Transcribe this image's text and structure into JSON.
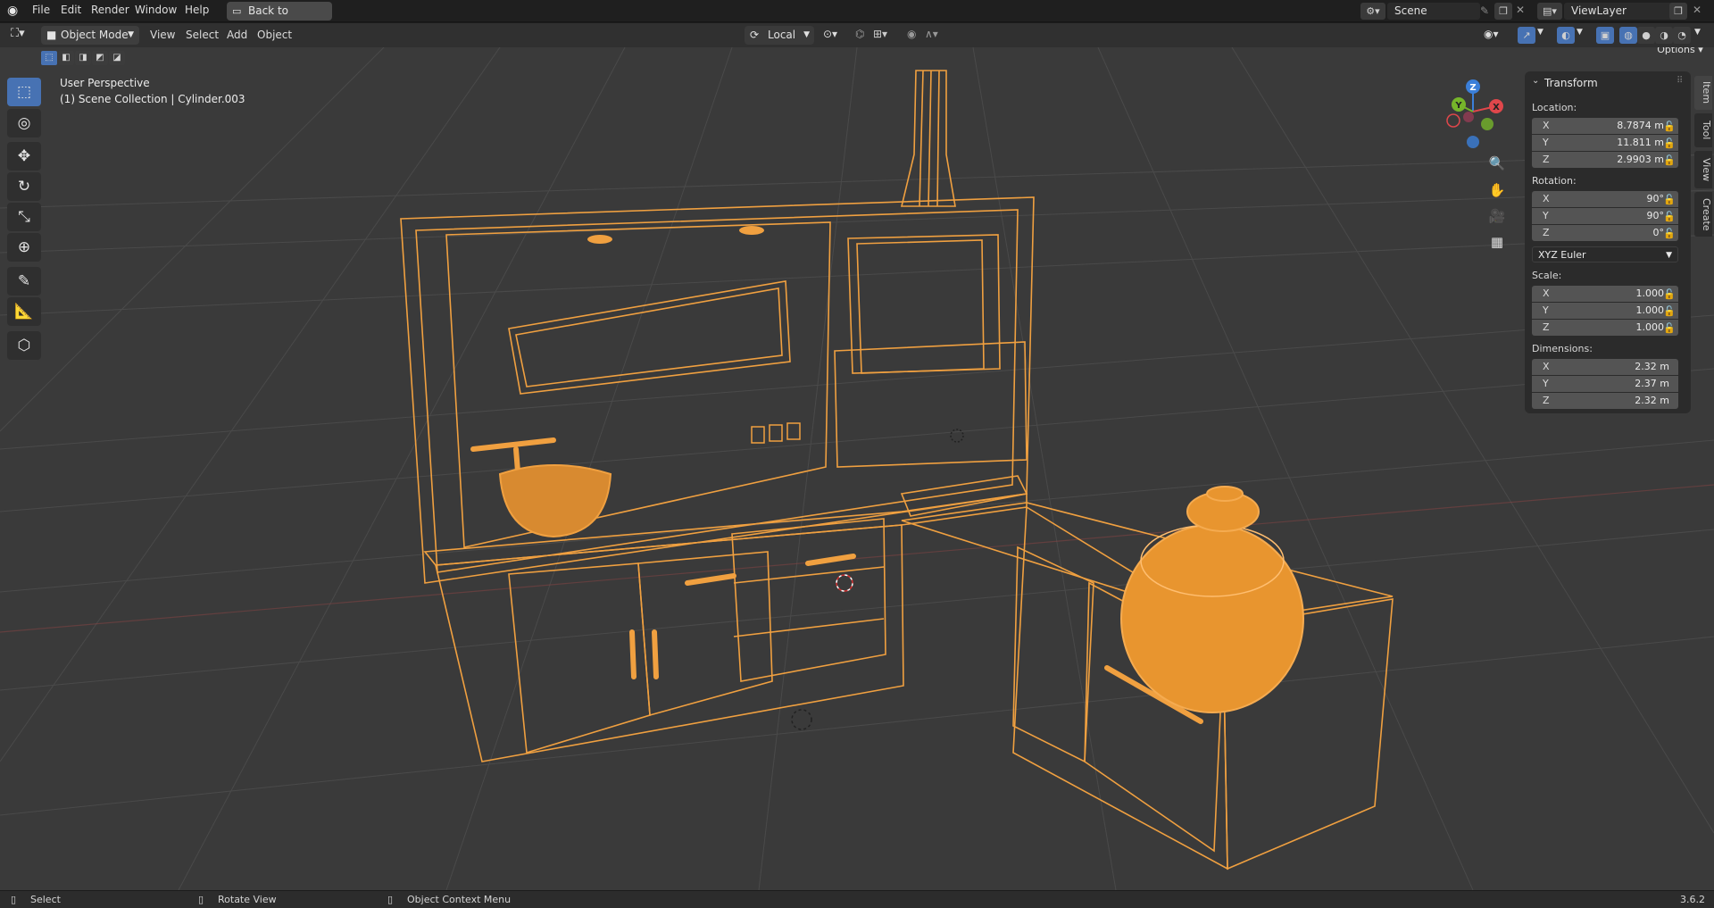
{
  "topbar": {
    "menus": [
      "File",
      "Edit",
      "Render",
      "Window",
      "Help"
    ],
    "back_button": "Back to Previous",
    "scene_name": "Scene",
    "view_layer_name": "ViewLayer"
  },
  "header": {
    "mode": "Object Mode",
    "menus": [
      "View",
      "Select",
      "Add",
      "Object"
    ],
    "transform_orientation": "Local",
    "options_label": "Options"
  },
  "viewport": {
    "perspective_label": "User Perspective",
    "collection_label": "(1) Scene Collection | Cylinder.003"
  },
  "sidebar_tabs": [
    "Item",
    "Tool",
    "View",
    "Create"
  ],
  "transform_panel": {
    "title": "Transform",
    "location_label": "Location:",
    "location": {
      "x": "8.7874 m",
      "y": "11.811 m",
      "z": "2.9903 m"
    },
    "rotation_label": "Rotation:",
    "rotation": {
      "x": "90°",
      "y": "90°",
      "z": "0°"
    },
    "rotation_mode": "XYZ Euler",
    "scale_label": "Scale:",
    "scale": {
      "x": "1.000",
      "y": "1.000",
      "z": "1.000"
    },
    "dimensions_label": "Dimensions:",
    "dimensions": {
      "x": "2.32 m",
      "y": "2.37 m",
      "z": "2.32 m"
    },
    "axis_labels": {
      "x": "X",
      "y": "Y",
      "z": "Z"
    }
  },
  "gizmo": {
    "x": "X",
    "y": "Y",
    "z": "Z"
  },
  "statusbar": {
    "select": "Select",
    "rotate_view": "Rotate View",
    "context_menu": "Object Context Menu",
    "version": "3.6.2"
  },
  "colors": {
    "accent": "#4772b3",
    "wire": "#f0a040",
    "viewport_bg": "#3a3a3a",
    "axis_x": "#e0474b",
    "axis_y": "#76b52a",
    "axis_z": "#3b7fd9"
  }
}
